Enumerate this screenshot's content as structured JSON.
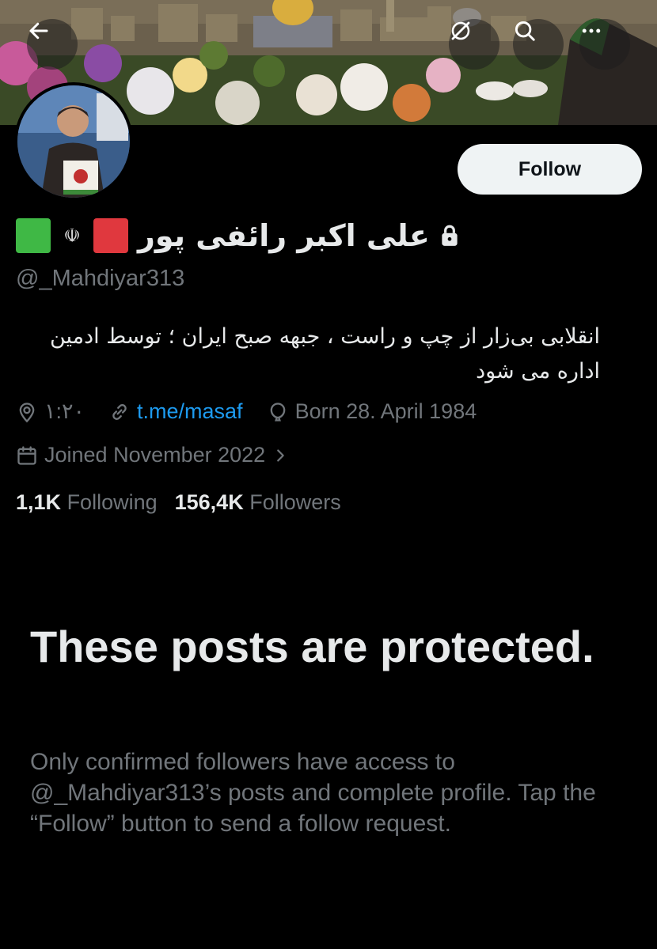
{
  "header": {
    "back_icon": "arrow-left-icon",
    "grok_icon": "grok-slash-icon",
    "search_icon": "search-icon",
    "more_icon": "more-horizontal-icon"
  },
  "profile": {
    "display_name": "علی اکبر رائفی پور",
    "handle": "@_Mahdiyar313",
    "follow_label": "Follow",
    "bio": "انقلابی بی‌زار از چپ و راست ، جبهه صبح ایران ؛ توسط ادمین اداره می شود",
    "location": "۱:۲۰",
    "link": "t.me/masaf",
    "birthday": "Born 28. April 1984",
    "joined": "Joined November 2022",
    "following_count": "1,1K",
    "following_label": "Following",
    "followers_count": "156,4K",
    "followers_label": "Followers",
    "emblem": "☫",
    "colors": {
      "green_square": "#3fb845",
      "red_square": "#e0383e",
      "link": "#1d9bf0",
      "muted": "#71767b"
    }
  },
  "protected": {
    "title": "These posts are protected.",
    "message": "Only confirmed followers have access to @_Mahdiyar313’s posts and complete profile. Tap the “Follow” button to send a follow request."
  }
}
